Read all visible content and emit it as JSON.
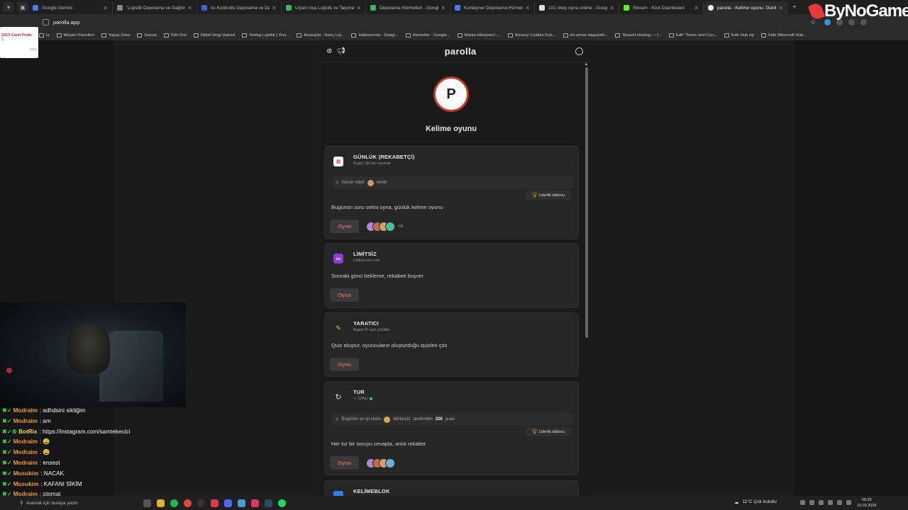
{
  "tabs": [
    {
      "title": "Google Gemini",
      "color": "#4a7cf0",
      "active": false
    },
    {
      "title": "\"Lojistik Depolama ve Dağıtım\"",
      "color": "#888888",
      "active": false
    },
    {
      "title": "Isı Kontrollü Depolama ve Dağı",
      "color": "#3464d8",
      "active": false
    },
    {
      "title": "Uçtan Uca Lojistik ve Taşımacılı",
      "color": "#3bb36a",
      "active": false
    },
    {
      "title": "Depolama Hizmetleri - Google",
      "color": "#3bb36a",
      "active": false
    },
    {
      "title": "Konteyner Depolama Hizmeti -",
      "color": "#4a7cf0",
      "active": false
    },
    {
      "title": "101 okey oyna online - Google",
      "color": "#dddddd",
      "active": false
    },
    {
      "title": "Stream - Kick Dashboard",
      "color": "#53fc18",
      "active": false
    },
    {
      "title": "parolla - Kelime oyunu. Günlük",
      "color": "#eeeeee",
      "active": true
    }
  ],
  "address": "parolla.app",
  "bookmarks": [
    "İş",
    "Müşteri Panelleri",
    "Yapay Zeka",
    "Sosyal",
    "Film Dizi",
    "Dijital Vergi Dairesi",
    "Netlog Lojistik | Yeni...",
    "Anasayfa - Genç Loj...",
    "Hakkımızda - Googl...",
    "Hizmetler - Google...",
    "Marka Hikayeleri -...",
    "Bouncy Castles Dub...",
    "mt-armor-daguzelh...",
    "Shared Hosting — f...",
    "Edit \"Terms and Con...",
    "İndir Hub zip",
    "İndir Minecraft Hub..."
  ],
  "widget": {
    "title": "2013 Canlı Perfo",
    "sub": "1",
    "foot": "osm"
  },
  "brand": "ByNoGame",
  "app": {
    "logo": "parolla",
    "avatar_letter": "P",
    "subtitle": "Kelime oyunu"
  },
  "cards": {
    "daily": {
      "icon": "calendar-icon",
      "title": "GÜNLÜK (REKABETÇİ)",
      "sub": "Bugün 166 kez oynandı",
      "leader_label": "Günün lideri",
      "leader_name": "nehirr",
      "leaderboard": "Liderlik tablosu",
      "desc": "Bugünün soru setini oyna, günlük kelime oyunu",
      "play": "Oyna",
      "more": "+6"
    },
    "unlimited": {
      "icon": "infinity-icon",
      "title": "LİMİTSİZ",
      "sub": "Limitsiz soru seti",
      "desc": "Sonraki günü bekleme, rekabeti boşver",
      "play": "Oyna"
    },
    "creative": {
      "icon": "pencil-icon",
      "title": "YARATICI",
      "sub": "Bugün 87 quiz çözüldü",
      "desc": "Quiz oluştur, oyuncuların oluşturduğu quizleri çöz",
      "play": "Oyna"
    },
    "tour": {
      "icon": "refresh-icon",
      "title": "TUR",
      "sub": "CANLI",
      "best_label": "Bugünün en iyi skoru",
      "best_user": "bilirkisi11",
      "best_mid": "tarafından",
      "best_score": "228",
      "best_unit": "puan",
      "leaderboard": "Liderlik tablosu",
      "desc": "Her tur bir soruyu cevapla, anlık rekabet",
      "play": "Oyna"
    },
    "block": {
      "title": "KELİMEBLOK"
    }
  },
  "chat": [
    {
      "user": "Modraim",
      "color": "#f0a030",
      "text": "adhdsini siktiğim"
    },
    {
      "user": "Modraim",
      "color": "#f0a030",
      "text": "am"
    },
    {
      "user": "BotRix",
      "color": "#ffd84a",
      "text": "https://instagram.com/samtekecici"
    },
    {
      "user": "Modraim",
      "color": "#f0a030",
      "text": "😩"
    },
    {
      "user": "Modraim",
      "color": "#f0a030",
      "text": "😩"
    },
    {
      "user": "Modraim",
      "color": "#f0a030",
      "text": "ensest"
    },
    {
      "user": "Musukim",
      "color": "#f0a030",
      "text": "NACAK"
    },
    {
      "user": "Musukim",
      "color": "#f0a030",
      "text": "KAFANI SİKİM"
    },
    {
      "user": "Modraim",
      "color": "#f0a030",
      "text": "otomat"
    }
  ],
  "taskbar": {
    "search": "Aramak için buraya yazın",
    "weather": "11°C  Çok bulutlu",
    "time": "00:29",
    "date": "10.03.2026"
  },
  "colors": {
    "accent": "#e2605a",
    "live": "#3ecf5a"
  }
}
